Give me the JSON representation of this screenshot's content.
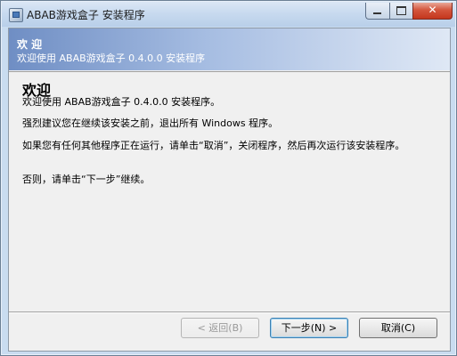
{
  "window": {
    "title": "ABAB游戏盒子 安装程序",
    "close_glyph": "✕"
  },
  "header": {
    "title": "欢 迎",
    "subtitle": "欢迎使用 ABAB游戏盒子 0.4.0.0 安装程序"
  },
  "content": {
    "heading": "欢迎",
    "paragraphs": [
      "欢迎使用 ABAB游戏盒子 0.4.0.0 安装程序。",
      "强烈建议您在继续该安装之前，退出所有 Windows 程序。",
      "如果您有任何其他程序正在运行，请单击“取消”，关闭程序，然后再次运行该安装程序。",
      "否则，请单击“下一步”继续。"
    ]
  },
  "buttons": {
    "back": "< 返回(B)",
    "next": "下一步(N) >",
    "cancel": "取消(C)"
  },
  "colors": {
    "header_gradient_start": "#6f8ec4",
    "header_gradient_end": "#dfe8f5",
    "close_button": "#d4563d"
  }
}
